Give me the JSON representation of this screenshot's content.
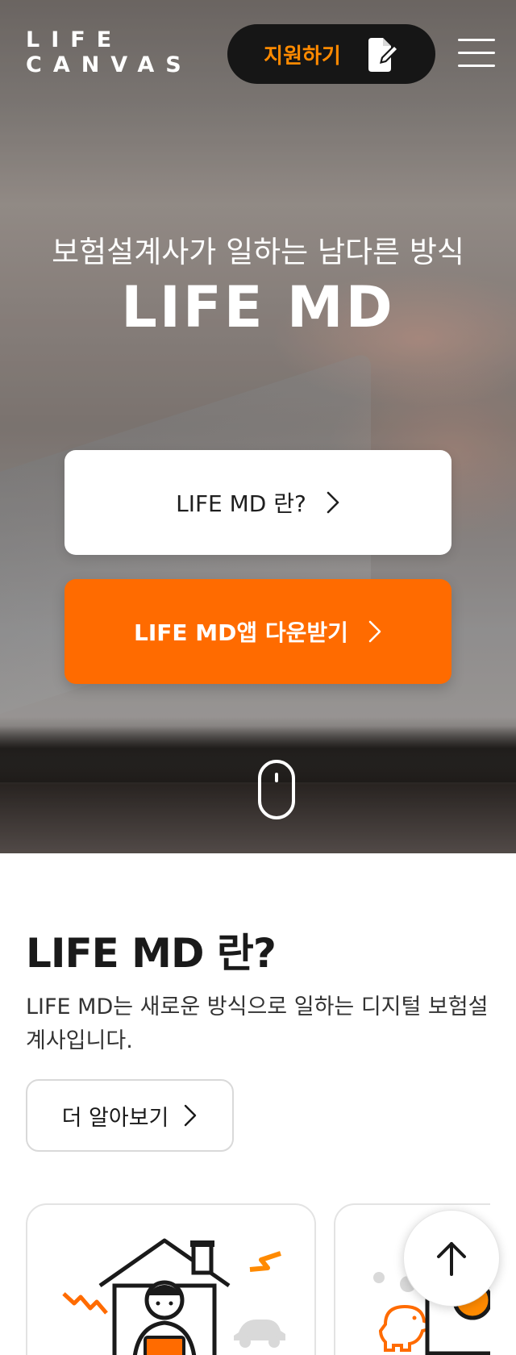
{
  "header": {
    "logo_line1": "LIFE",
    "logo_line2": "CANVAS",
    "apply_label": "지원하기",
    "apply_icon": "edit-document-icon",
    "menu_icon": "hamburger-menu-icon"
  },
  "hero": {
    "subtitle": "보험설계사가 일하는 남다른 방식",
    "title": "LIFE MD",
    "primary_button": "LIFE MD 란?",
    "app_button": "LIFE MD앱 다운받기",
    "scroll_icon": "mouse-scroll-icon"
  },
  "about": {
    "title": "LIFE MD 란?",
    "description": "LIFE MD는 새로운 방식으로 일하는 디지털 보험설계사입니다.",
    "more_button": "더 알아보기"
  },
  "cards": [
    {
      "illustration": "home-work-laptop-icon"
    },
    {
      "illustration": "piggy-bank-laptop-icon"
    }
  ],
  "colors": {
    "accent": "#ff6b00",
    "apply_text": "#ff8a00",
    "dark": "#161616"
  },
  "to_top_icon": "arrow-up-icon"
}
